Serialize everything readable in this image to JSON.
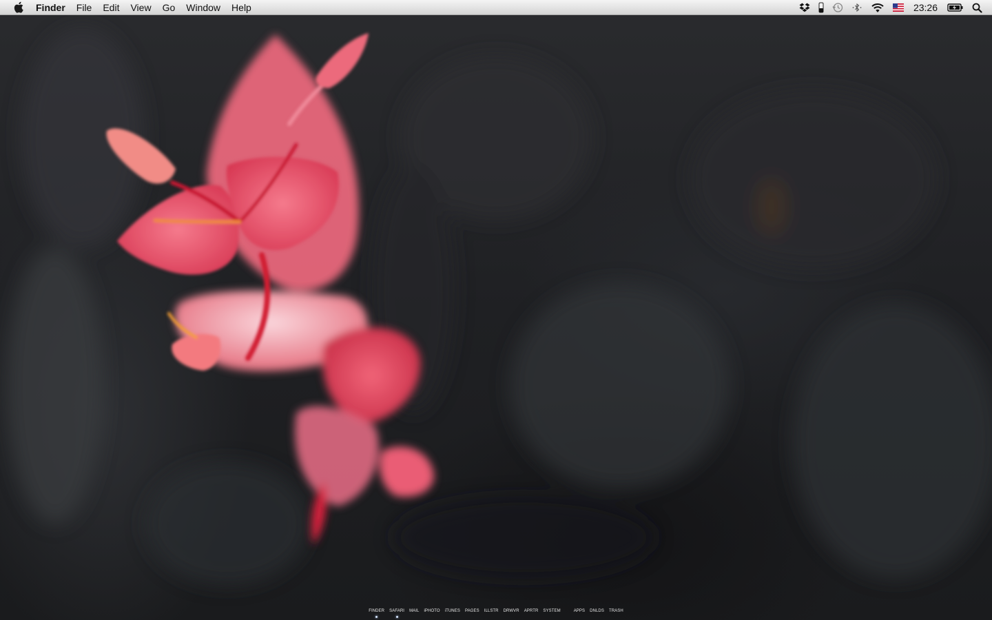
{
  "menubar": {
    "app_name": "Finder",
    "menus": [
      "File",
      "Edit",
      "View",
      "Go",
      "Window",
      "Help"
    ],
    "status_icons": [
      "dropbox-icon",
      "phone-icon",
      "time-machine-icon",
      "bluetooth-icon",
      "wifi-icon",
      "us-flag-icon"
    ],
    "clock": "23:26",
    "colors": {
      "bar_top": "#f4f4f4",
      "bar_bottom": "#d4d4d4",
      "text": "#111111"
    }
  },
  "desktop": {
    "wallpaper": "blurred dark bark with pink flower",
    "colors": {
      "background": "#1c1d20",
      "petal": "#e8506a",
      "petal_light": "#f2a6b2",
      "stem": "#d01a30"
    }
  },
  "dock": {
    "apps": [
      {
        "label": "FINDER",
        "running": true
      },
      {
        "label": "SAFARI",
        "running": true
      },
      {
        "label": "MAIL",
        "running": false
      },
      {
        "label": "iPHOTO",
        "running": false
      },
      {
        "label": "iTUNES",
        "running": false
      },
      {
        "label": "PAGES",
        "running": false
      },
      {
        "label": "ILLSTR",
        "running": false
      },
      {
        "label": "DRWVR",
        "running": false
      },
      {
        "label": "APRTR",
        "running": false
      },
      {
        "label": "SYSTEM",
        "running": false
      }
    ],
    "stacks": [
      {
        "label": "APPS"
      },
      {
        "label": "DNLDS"
      },
      {
        "label": "TRASH"
      }
    ]
  }
}
